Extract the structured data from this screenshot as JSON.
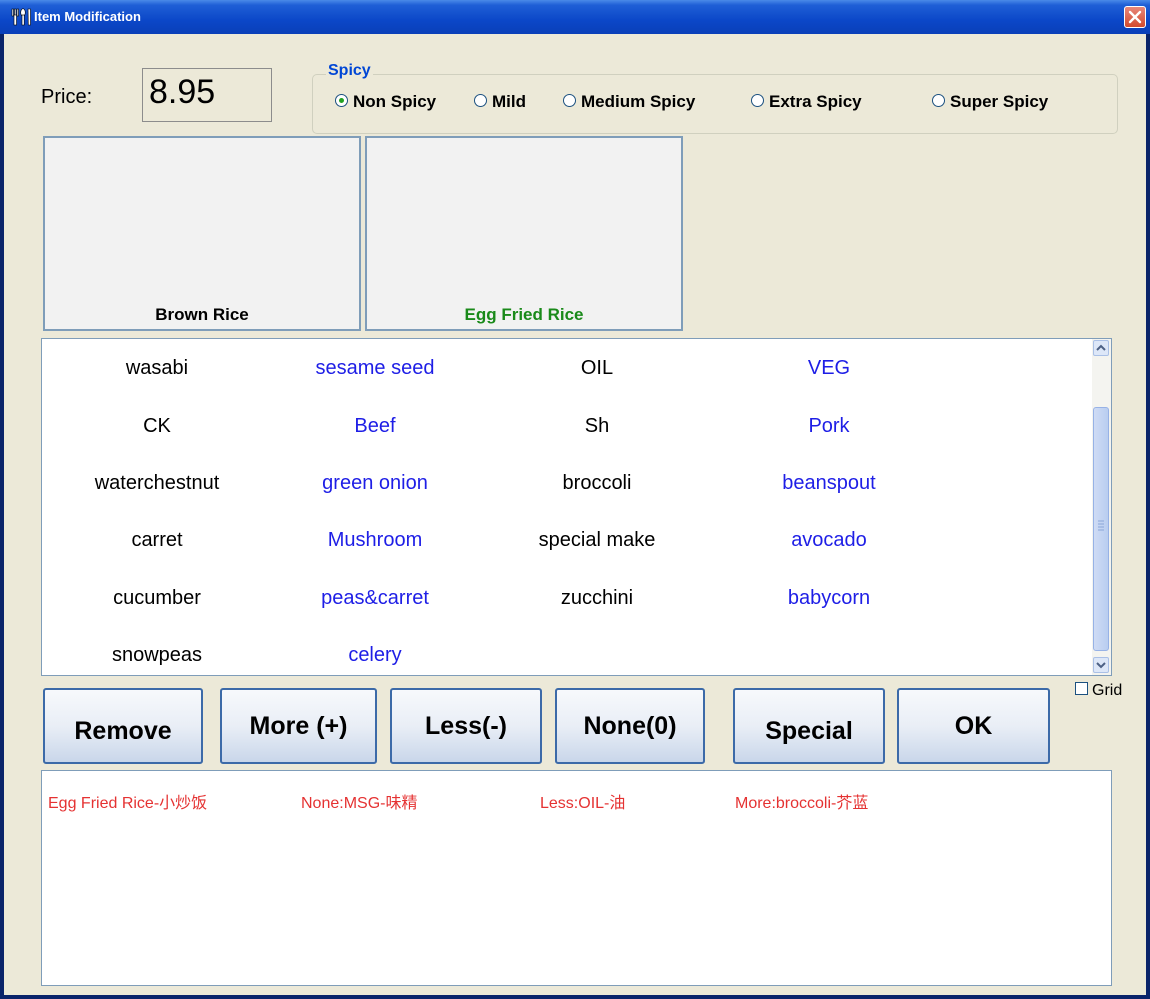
{
  "window": {
    "title": "Item Modification"
  },
  "price": {
    "label": "Price:",
    "value": "8.95"
  },
  "spicy": {
    "legend": "Spicy",
    "options": [
      {
        "label": "Non Spicy",
        "selected": true
      },
      {
        "label": "Mild",
        "selected": false
      },
      {
        "label": "Medium Spicy",
        "selected": false
      },
      {
        "label": "Extra Spicy",
        "selected": false
      },
      {
        "label": "Super Spicy",
        "selected": false
      }
    ]
  },
  "options_tiles": [
    {
      "label": "Brown Rice",
      "color": "#000000"
    },
    {
      "label": "Egg Fried Rice",
      "color": "#1a8a1a"
    }
  ],
  "ingredients": {
    "rows": [
      [
        "wasabi",
        "sesame seed",
        "OIL",
        "VEG"
      ],
      [
        "CK",
        "Beef",
        "Sh",
        "Pork"
      ],
      [
        "waterchestnut",
        "green onion",
        "broccoli",
        "beanspout"
      ],
      [
        "carret",
        "Mushroom",
        "special make",
        "avocado"
      ],
      [
        "cucumber",
        "peas&carret",
        "zucchini",
        "babycorn"
      ],
      [
        "snowpeas",
        "celery",
        "",
        ""
      ]
    ],
    "colors": {
      "black_col": "#000000",
      "blue_col": "#1e1ee6"
    }
  },
  "grid_checkbox": {
    "label": "Grid",
    "checked": false
  },
  "buttons": {
    "remove": "Remove",
    "more": "More (+)",
    "less": "Less(-)",
    "none": "None(0)",
    "special": "Special",
    "ok": "OK"
  },
  "modifications": [
    "Egg Fried Rice-小炒饭",
    "None:MSG-味精",
    "Less:OIL-油",
    "More:broccoli-芥蓝"
  ],
  "colors": {
    "title_bar": "#0b47c8",
    "mod_text": "#e53232",
    "legend": "#0046d5"
  }
}
